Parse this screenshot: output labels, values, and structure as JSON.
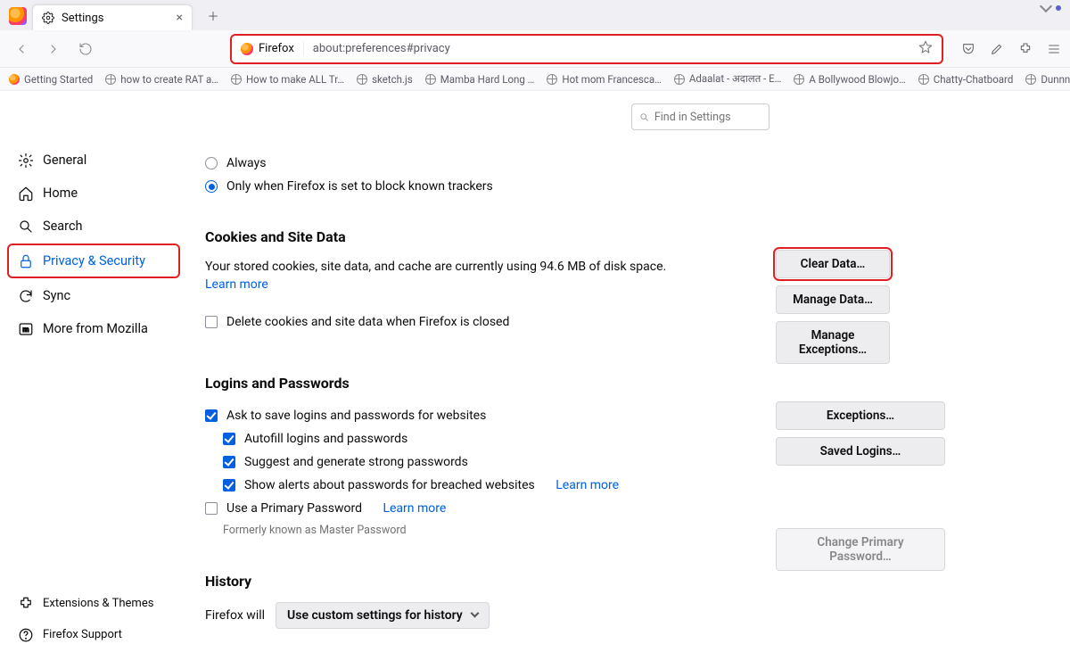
{
  "tab": {
    "title": "Settings"
  },
  "urlbar": {
    "identity": "Firefox",
    "url": "about:preferences#privacy"
  },
  "bookmarks": [
    {
      "label": "Getting Started",
      "icon": "ff"
    },
    {
      "label": "how to create RAT a…",
      "icon": "globe"
    },
    {
      "label": "How to make ALL Tr…",
      "icon": "globe"
    },
    {
      "label": "sketch.js",
      "icon": "globe"
    },
    {
      "label": "Mamba Hard Long …",
      "icon": "globe"
    },
    {
      "label": "Hot mom Francesca…",
      "icon": "globe"
    },
    {
      "label": "Adaalat - अदालत - E…",
      "icon": "globe"
    },
    {
      "label": "A Bollywood Blowjo…",
      "icon": "globe"
    },
    {
      "label": "Chatty-Chatboard",
      "icon": "globe"
    },
    {
      "label": "Dunnnk - Generate …",
      "icon": "globe"
    }
  ],
  "find_placeholder": "Find in Settings",
  "sidebar": {
    "items": [
      {
        "label": "General"
      },
      {
        "label": "Home"
      },
      {
        "label": "Search"
      },
      {
        "label": "Privacy & Security"
      },
      {
        "label": "Sync"
      },
      {
        "label": "More from Mozilla"
      }
    ],
    "bottom": [
      {
        "label": "Extensions & Themes"
      },
      {
        "label": "Firefox Support"
      }
    ]
  },
  "trackers": {
    "always": "Always",
    "only_block": "Only when Firefox is set to block known trackers"
  },
  "cookies": {
    "heading": "Cookies and Site Data",
    "desc": "Your stored cookies, site data, and cache are currently using 94.6 MB of disk space.",
    "learn": "Learn more",
    "delete_on_close": "Delete cookies and site data when Firefox is closed",
    "clear": "Clear Data…",
    "manage": "Manage Data…",
    "exceptions": "Manage Exceptions…"
  },
  "logins": {
    "heading": "Logins and Passwords",
    "ask": "Ask to save logins and passwords for websites",
    "autofill": "Autofill logins and passwords",
    "suggest": "Suggest and generate strong passwords",
    "alerts": "Show alerts about passwords for breached websites",
    "alerts_learn": "Learn more",
    "primary": "Use a Primary Password",
    "primary_learn": "Learn more",
    "primary_caption": "Formerly known as Master Password",
    "exceptions": "Exceptions…",
    "saved": "Saved Logins…",
    "change_primary": "Change Primary Password…"
  },
  "history": {
    "heading": "History",
    "prefix": "Firefox will",
    "mode": "Use custom settings for history"
  }
}
